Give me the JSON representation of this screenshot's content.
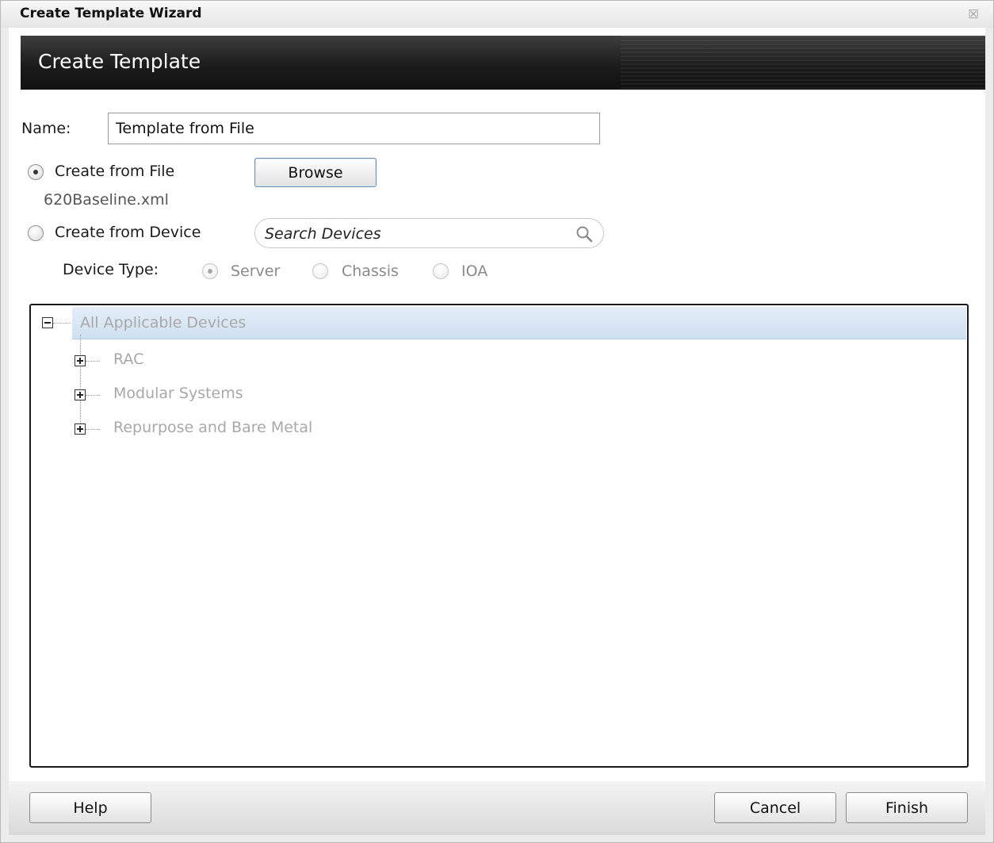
{
  "window": {
    "title": "Create Template Wizard",
    "close_glyph": "☒"
  },
  "header": {
    "title": "Create Template"
  },
  "form": {
    "name_label": "Name:",
    "name_value": "Template from File",
    "create_from_file_label": "Create from File",
    "create_from_file_checked": true,
    "browse_label": "Browse",
    "selected_file": "620Baseline.xml",
    "create_from_device_label": "Create from Device",
    "create_from_device_checked": false,
    "search_placeholder": "Search Devices",
    "device_type_label": "Device Type:",
    "device_types": [
      {
        "label": "Server",
        "checked": true
      },
      {
        "label": "Chassis",
        "checked": false
      },
      {
        "label": "IOA",
        "checked": false
      }
    ]
  },
  "tree": {
    "root": {
      "label": "All Applicable Devices",
      "expanded": true
    },
    "children": [
      {
        "label": "RAC",
        "expanded": false
      },
      {
        "label": "Modular Systems",
        "expanded": false
      },
      {
        "label": "Repurpose and Bare Metal",
        "expanded": false
      }
    ]
  },
  "footer": {
    "help_label": "Help",
    "cancel_label": "Cancel",
    "finish_label": "Finish"
  },
  "colors": {
    "header_bg": "#1c1c1c",
    "tree_selected_bg": "#d6e6f5",
    "disabled_text": "#a8a8a8"
  }
}
